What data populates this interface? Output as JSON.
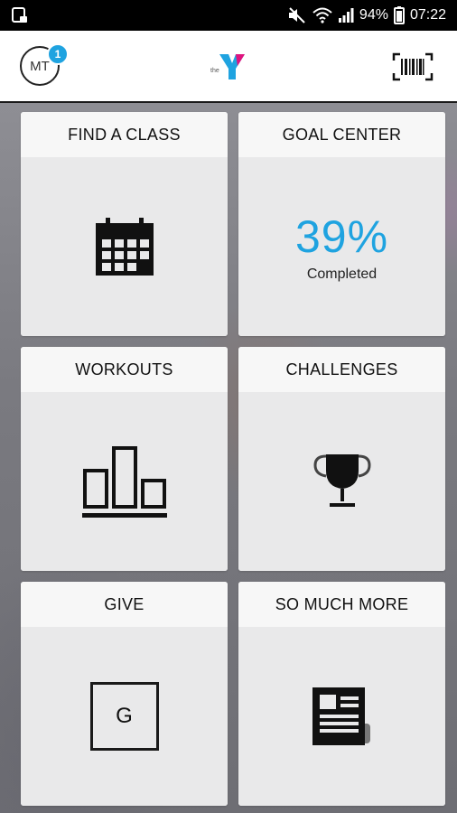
{
  "status_bar": {
    "battery": "94%",
    "time": "07:22"
  },
  "header": {
    "avatar_initials": "MT",
    "notification_count": "1",
    "logo_text": "the"
  },
  "tiles": [
    {
      "title": "FIND A CLASS",
      "icon": "calendar-icon"
    },
    {
      "title": "GOAL CENTER",
      "value": "39%",
      "caption": "Completed"
    },
    {
      "title": "WORKOUTS",
      "icon": "bar-chart-icon"
    },
    {
      "title": "CHALLENGES",
      "icon": "trophy-icon"
    },
    {
      "title": "GIVE",
      "icon_letter": "G"
    },
    {
      "title": "SO MUCH MORE",
      "icon": "newspaper-icon"
    }
  ],
  "colors": {
    "accent": "#1fa3e0",
    "logo_magenta": "#e0137e",
    "logo_cyan": "#1fa3e0"
  }
}
